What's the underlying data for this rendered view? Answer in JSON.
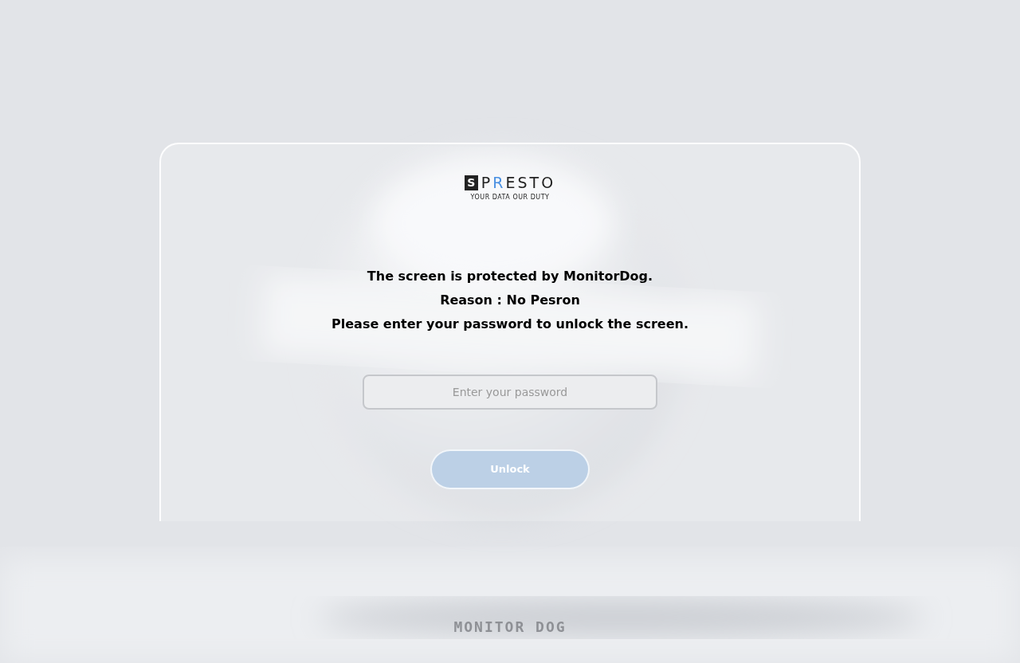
{
  "logo": {
    "badge": "S",
    "word": "PRESTO",
    "tagline": "YOUR DATA OUR DUTY"
  },
  "messages": [
    "The screen is protected by MonitorDog.",
    "Reason : No Pesron",
    "Please enter your password to unlock the screen."
  ],
  "password": {
    "placeholder": "Enter your password"
  },
  "unlock_button": {
    "label": "Unlock",
    "disabled": true
  },
  "footer_logo": "MONITOR DOG"
}
